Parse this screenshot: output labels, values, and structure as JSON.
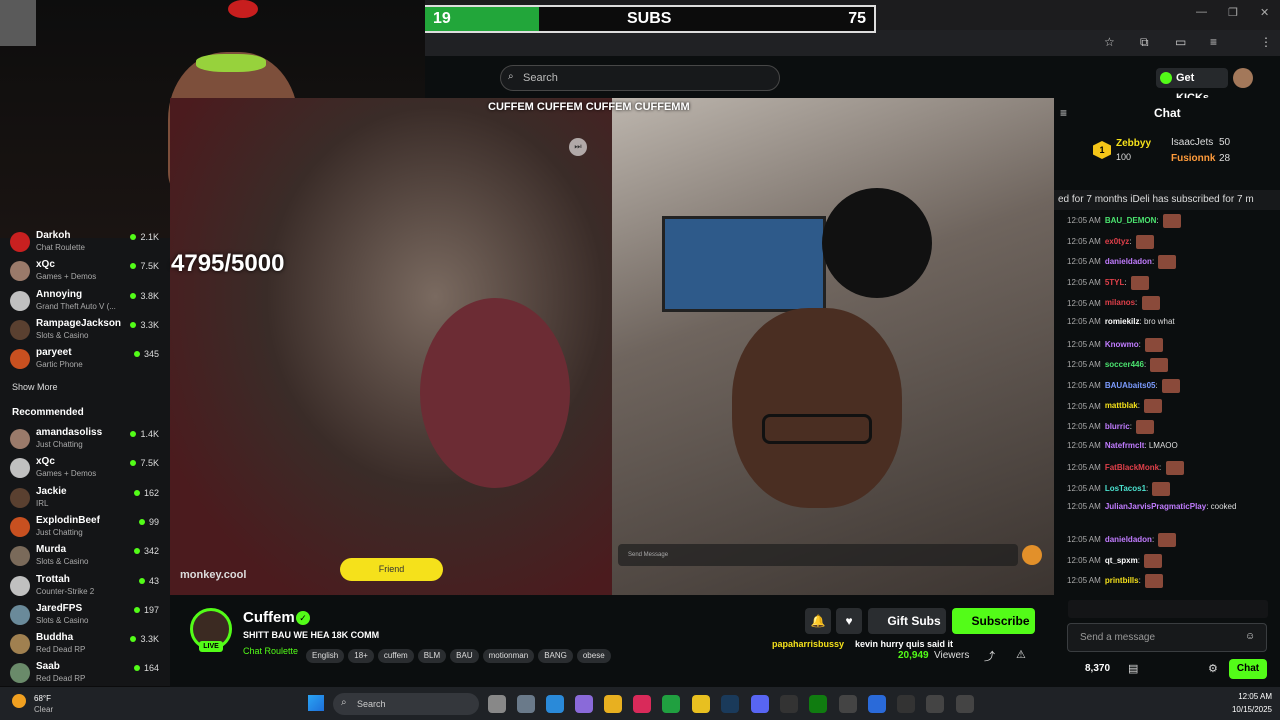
{
  "window": {
    "minimize": "—",
    "restore": "❐",
    "close": "✕"
  },
  "subs_bar": {
    "current": "19",
    "label": "SUBS",
    "goal": "75",
    "progress": 0.253
  },
  "header": {
    "search_placeholder": "Search",
    "get_kicks": "Get KICKs"
  },
  "sidebar": {
    "items": [
      {
        "name": "Darkoh",
        "sub": "Chat Roulette",
        "viewers": "2.1K"
      },
      {
        "name": "xQc",
        "sub": "Games + Demos",
        "viewers": "7.5K"
      },
      {
        "name": "Annoying",
        "sub": "Grand Theft Auto V (...",
        "viewers": "3.8K"
      },
      {
        "name": "RampageJackson",
        "sub": "Slots & Casino",
        "viewers": "3.3K"
      },
      {
        "name": "paryeet",
        "sub": "Gartic Phone",
        "viewers": "345"
      }
    ],
    "show_more": "Show More",
    "recommended_title": "Recommended",
    "recommended": [
      {
        "name": "amandasoliss",
        "sub": "Just Chatting",
        "viewers": "1.4K"
      },
      {
        "name": "xQc",
        "sub": "Games + Demos",
        "viewers": "7.5K"
      },
      {
        "name": "Jackie",
        "sub": "IRL",
        "viewers": "162"
      },
      {
        "name": "ExplodinBeef",
        "sub": "Just Chatting",
        "viewers": "99"
      },
      {
        "name": "Murda",
        "sub": "Slots & Casino",
        "viewers": "342"
      },
      {
        "name": "Trottah",
        "sub": "Counter-Strike 2",
        "viewers": "43"
      },
      {
        "name": "JaredFPS",
        "sub": "Slots & Casino",
        "viewers": "197"
      },
      {
        "name": "Buddha",
        "sub": "Red Dead RP",
        "viewers": "3.3K"
      },
      {
        "name": "Saab",
        "sub": "Red Dead RP",
        "viewers": "164"
      }
    ]
  },
  "video": {
    "counter": "4795/5000",
    "socials": "CUFFEM  CUFFEM  CUFFEM  CUFFEMM",
    "watermark": "monkey.cool",
    "friend_button": "Friend",
    "send_message": "Send Message"
  },
  "channel": {
    "name": "Cuffem",
    "title": "SHITT BAU WE HEA 18K COMM",
    "category": "Chat Roulette",
    "live": "LIVE",
    "tags": [
      "English",
      "18+",
      "cuffem",
      "BLM",
      "BAU",
      "motionman",
      "BANG",
      "obese"
    ],
    "gift_subs": "Gift Subs",
    "subscribe": "Subscribe",
    "viewers": "20,949",
    "viewers_label": "Viewers",
    "pinned_user": "papaharrisbussy",
    "pinned_text": "kevin hurry quis said it"
  },
  "chat": {
    "title": "Chat",
    "leaders": [
      {
        "rank": "1",
        "name": "Zebbyy",
        "count": "100"
      },
      {
        "name": "IsaacJets",
        "count": "50"
      },
      {
        "name": "Fusionnk",
        "count": "28"
      }
    ],
    "ticker": "ed for 7 months  iDeli has subscribed for 7 m",
    "messages": [
      {
        "time": "12:05 AM",
        "user": "BAU_DEMON",
        "color": "#4be36f",
        "text": ""
      },
      {
        "time": "12:05 AM",
        "user": "ex0tyz",
        "color": "#e0404a",
        "text": ""
      },
      {
        "time": "12:05 AM",
        "user": "danieldadon",
        "color": "#c17cff",
        "text": ""
      },
      {
        "time": "12:05 AM",
        "user": "5TYL",
        "color": "#e0404a",
        "text": ""
      },
      {
        "time": "12:05 AM",
        "user": "milanos",
        "color": "#e0404a",
        "text": ""
      },
      {
        "time": "12:05 AM",
        "user": "romiekilz",
        "color": "#ffffff",
        "text": "bro what"
      },
      {
        "time": "12:05 AM",
        "user": "Knowmo",
        "color": "#c17cff",
        "text": ""
      },
      {
        "time": "12:05 AM",
        "user": "soccer446",
        "color": "#4be36f",
        "text": ""
      },
      {
        "time": "12:05 AM",
        "user": "BAUAbaits05",
        "color": "#7c9cff",
        "text": ""
      },
      {
        "time": "12:05 AM",
        "user": "mattblak",
        "color": "#f5e11b",
        "text": ""
      },
      {
        "time": "12:05 AM",
        "user": "blurric",
        "color": "#c17cff",
        "text": ""
      },
      {
        "time": "12:05 AM",
        "user": "Natefrmclt",
        "color": "#c17cff",
        "text": "LMAOO"
      },
      {
        "time": "12:05 AM",
        "user": "FatBlackMonk",
        "color": "#e0404a",
        "text": ""
      },
      {
        "time": "12:05 AM",
        "user": "LosTacos1",
        "color": "#4be3d0",
        "text": ""
      },
      {
        "time": "12:05 AM",
        "user": "JulianJarvisPragmaticPlay",
        "color": "#c17cff",
        "text": "cooked"
      },
      {
        "time": "12:05 AM",
        "user": "danieldadon",
        "color": "#c17cff",
        "text": ""
      },
      {
        "time": "12:05 AM",
        "user": "qt_spxm",
        "color": "#ffffff",
        "text": ""
      },
      {
        "time": "12:05 AM",
        "user": "printbills",
        "color": "#f5e11b",
        "text": ""
      }
    ],
    "input_placeholder": "Send a message",
    "points": "8,370",
    "chat_button": "Chat"
  },
  "taskbar": {
    "weather_temp": "68°F",
    "weather_text": "Clear",
    "search": "Search",
    "time": "12:05 AM",
    "date": "10/15/2025"
  },
  "colors": {
    "kick_green": "#53fc18",
    "bar_green": "#22a63a"
  }
}
